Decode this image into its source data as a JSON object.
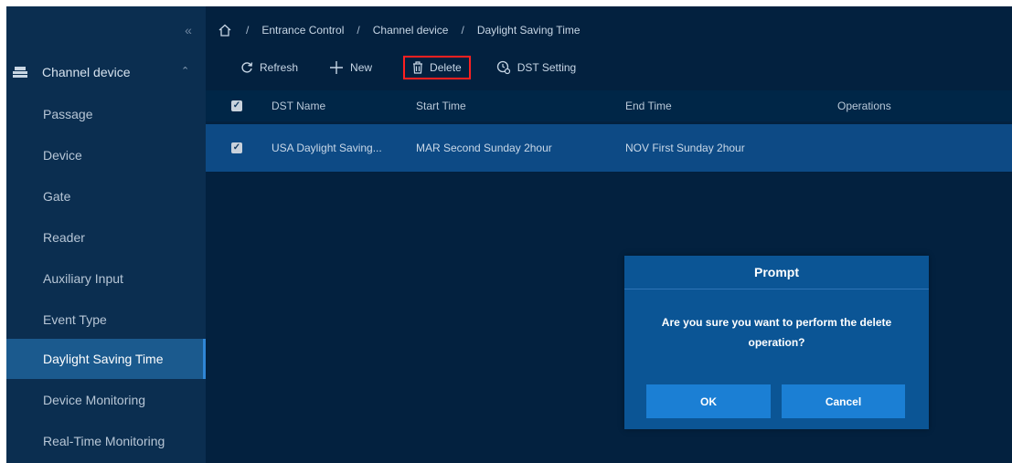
{
  "sidebar": {
    "collapse_icon": "double-chevron-left-icon",
    "group": {
      "label": "Channel device",
      "icon": "stack-icon"
    },
    "items": [
      {
        "label": "Passage"
      },
      {
        "label": "Device"
      },
      {
        "label": "Gate"
      },
      {
        "label": "Reader"
      },
      {
        "label": "Auxiliary Input"
      },
      {
        "label": "Event Type"
      },
      {
        "label": "Daylight Saving Time",
        "active": true
      },
      {
        "label": "Device Monitoring"
      },
      {
        "label": "Real-Time Monitoring"
      }
    ]
  },
  "breadcrumb": {
    "home_icon": "home-icon",
    "items": [
      "Entrance Control",
      "Channel device",
      "Daylight Saving Time"
    ],
    "separator": "/"
  },
  "toolbar": {
    "refresh": "Refresh",
    "new": "New",
    "delete": "Delete",
    "dst_setting": "DST Setting"
  },
  "table": {
    "headers": [
      "DST Name",
      "Start Time",
      "End Time",
      "Operations"
    ],
    "rows": [
      {
        "name": "USA Daylight Saving...",
        "start": "MAR Second Sunday 2hour",
        "end": "NOV First Sunday 2hour",
        "checked": true
      }
    ]
  },
  "dialog": {
    "title": "Prompt",
    "message_line1": "Are you sure you want to perform the delete",
    "message_line2": "operation?",
    "ok": "OK",
    "cancel": "Cancel"
  },
  "colors": {
    "background": "#03213f",
    "sidebar": "#0b2e50",
    "active_item": "#1b5a8e",
    "selected_row": "#0d4a85",
    "dialog": "#0b5595",
    "button": "#1b7fd4",
    "highlight_border": "#ff2020"
  }
}
